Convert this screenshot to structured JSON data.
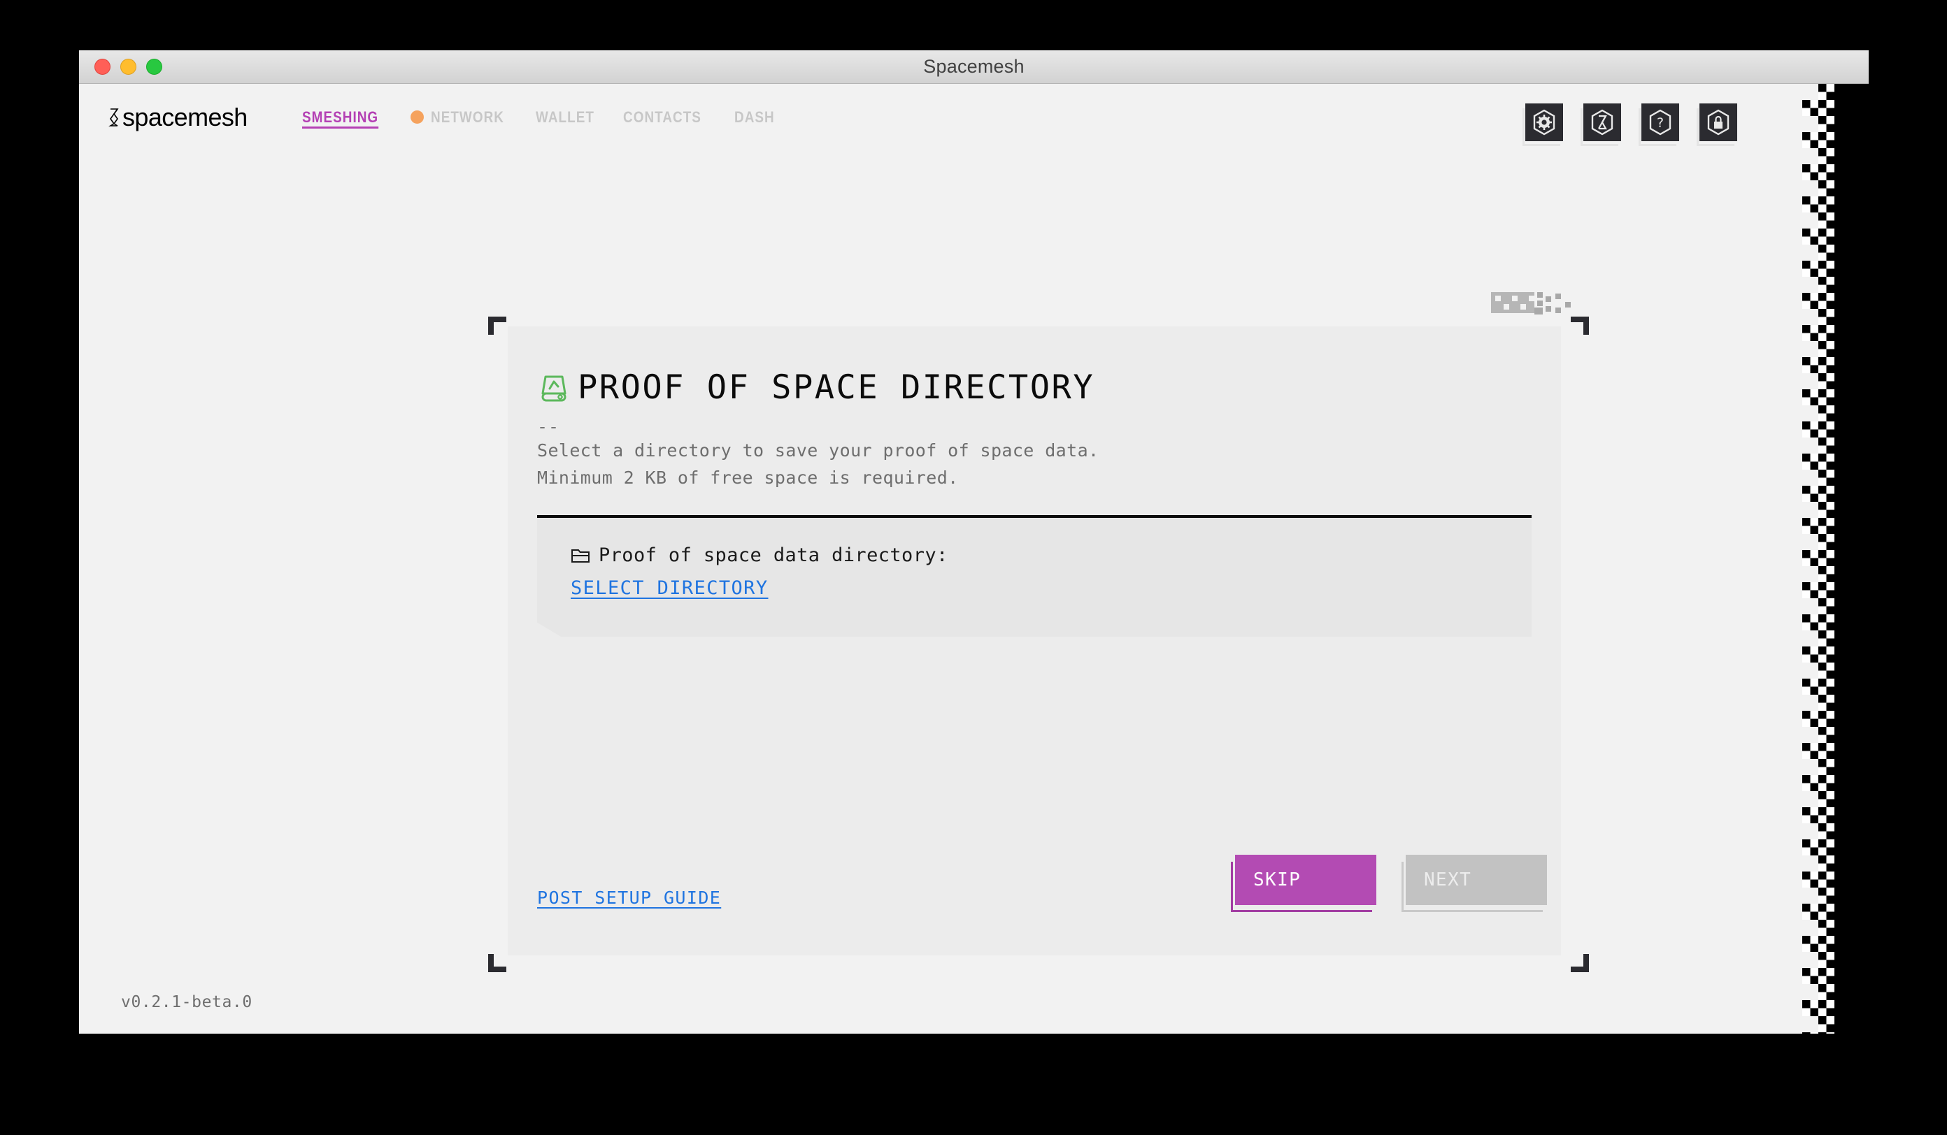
{
  "window": {
    "title": "Spacemesh",
    "controls": [
      "close",
      "minimize",
      "maximize"
    ]
  },
  "header": {
    "brand": "spacemesh",
    "brand_mark_icon": "spacemesh-hourglass-icon",
    "nav": [
      {
        "label": "SMESHING",
        "active": true,
        "dot": false
      },
      {
        "label": "NETWORK",
        "active": false,
        "dot": true
      },
      {
        "label": "WALLET",
        "active": false,
        "dot": false
      },
      {
        "label": "CONTACTS",
        "active": false,
        "dot": false
      },
      {
        "label": "DASH",
        "active": false,
        "dot": false
      }
    ],
    "tools": [
      {
        "name": "settings-button",
        "icon": "gear-icon",
        "glyph": "gear"
      },
      {
        "name": "network-button",
        "icon": "hourglass-icon",
        "glyph": "hourglass"
      },
      {
        "name": "help-button",
        "icon": "question-icon",
        "glyph": "?"
      },
      {
        "name": "lock-button",
        "icon": "lock-icon",
        "glyph": "lock"
      }
    ]
  },
  "card": {
    "icon": "hard-drive-mining-icon",
    "title": "PROOF OF SPACE DIRECTORY",
    "dashes": "--",
    "description_line1": "Select a directory to save your proof of space data.",
    "description_line2": "Minimum 2 KB of free space is required.",
    "panel": {
      "folder_icon": "folder-icon",
      "label": "Proof of space data directory:",
      "select_link": "SELECT DIRECTORY"
    },
    "footer": {
      "guide_link": "POST SETUP GUIDE",
      "skip_button": "SKIP",
      "next_button": "NEXT"
    }
  },
  "status": {
    "version": "v0.2.1-beta.0"
  },
  "colors": {
    "accent_purple": "#b34bb3",
    "link_blue": "#1f74e0",
    "nav_active": "#b440b4",
    "network_dot": "#f5a25d",
    "drive_green": "#5cb85c",
    "page_bg": "#f2f2f2",
    "card_bg": "#ececec",
    "panel_bg": "#e6e6e6",
    "tool_bg": "#2b2b30"
  }
}
